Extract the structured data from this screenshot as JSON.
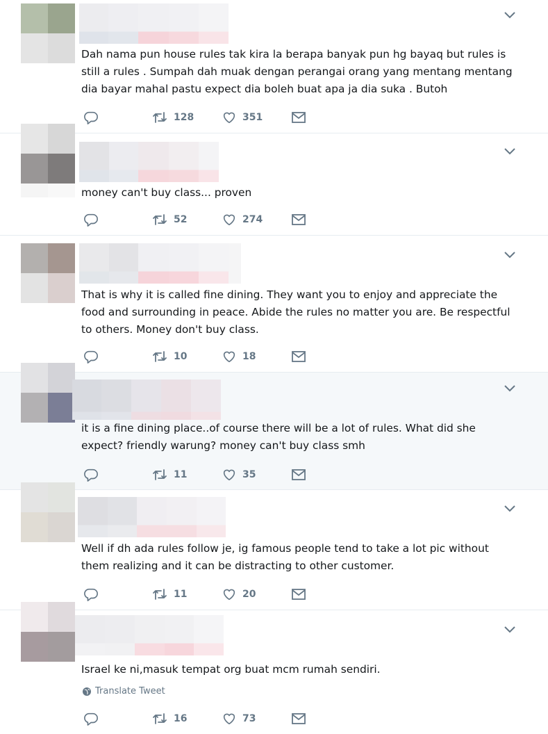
{
  "tweets": [
    {
      "text": "Dah nama pun house rules tak kira la berapa banyak pun hg bayaq but rules is still a rules . Sumpah dah muak dengan perangai orang yang mentang mentang dia bayar mahal pastu expect dia boleh buat apa ja dia suka . Butoh",
      "retweets": "128",
      "likes": "351"
    },
    {
      "text": "money can't buy class... proven",
      "retweets": "52",
      "likes": "274"
    },
    {
      "text": "That is why it is called fine dining. They want you to enjoy and appreciate the food and surrounding in peace. Abide the rules no matter you are. Be respectful to others. Money don't buy class.",
      "retweets": "10",
      "likes": "18"
    },
    {
      "text": "it is a fine dining place..of course there will be a lot of rules. What did she expect? friendly warung? money can't buy class smh",
      "retweets": "11",
      "likes": "35"
    },
    {
      "text": "Well if dh ada rules follow je, ig famous people tend to take a lot pic without them realizing and it can be distracting to other customer.",
      "retweets": "11",
      "likes": "20"
    },
    {
      "text": "Israel ke ni,masuk tempat org buat mcm rumah sendiri.",
      "translate_label": "Translate Tweet",
      "retweets": "16",
      "likes": "73"
    }
  ],
  "colors": {
    "icon": "#657786",
    "divider": "#e6ecf0",
    "highlight_background": "#f5f8fa",
    "text": "#14171a"
  }
}
